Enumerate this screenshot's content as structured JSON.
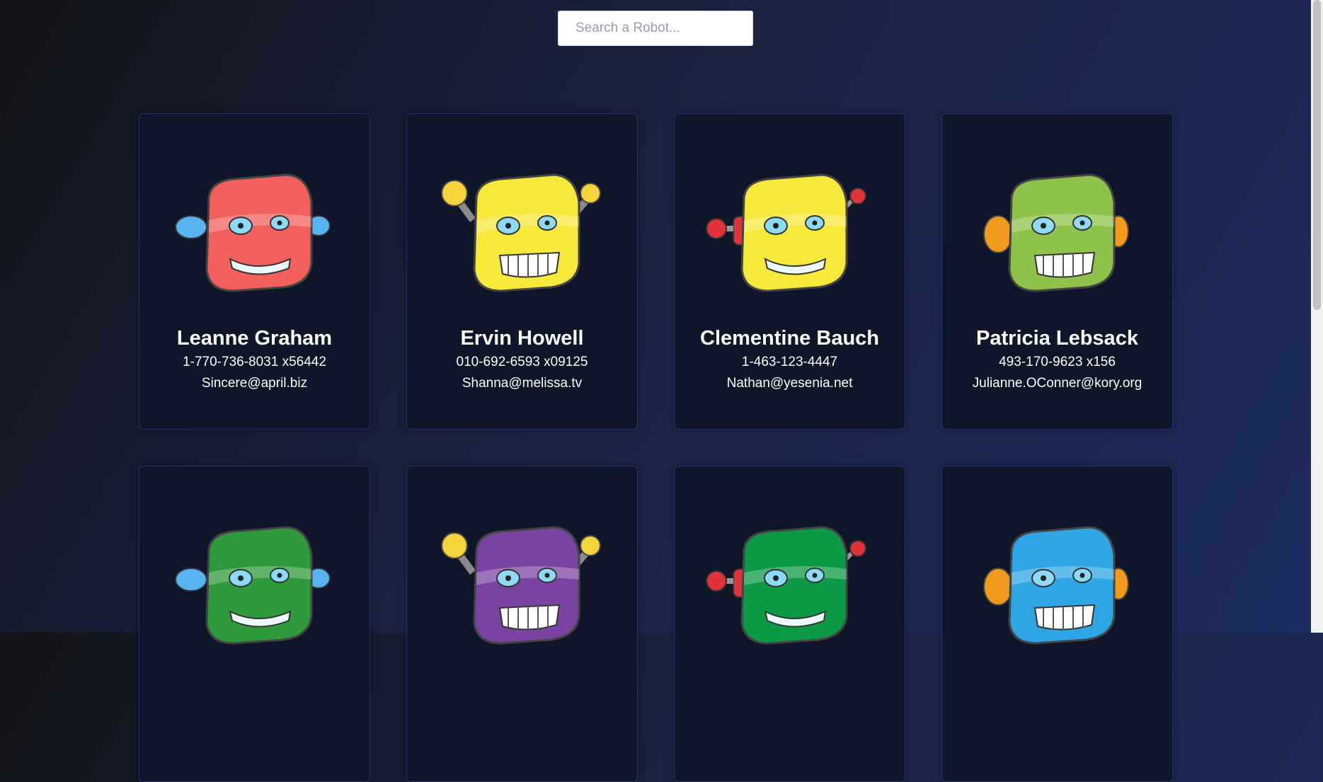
{
  "search": {
    "placeholder": "Search a Robot..."
  },
  "robots": [
    {
      "name": "Leanne Graham",
      "phone": "1-770-736-8031 x56442",
      "email": "Sincere@april.biz",
      "color": "#f2605e"
    },
    {
      "name": "Ervin Howell",
      "phone": "010-692-6593 x09125",
      "email": "Shanna@melissa.tv",
      "color": "#f6e93b"
    },
    {
      "name": "Clementine Bauch",
      "phone": "1-463-123-4447",
      "email": "Nathan@yesenia.net",
      "color": "#f6e93b"
    },
    {
      "name": "Patricia Lebsack",
      "phone": "493-170-9623 x156",
      "email": "Julianne.OConner@kory.org",
      "color": "#8fc24a"
    },
    {
      "name": "",
      "phone": "",
      "email": "",
      "color": "#2f9a3c"
    },
    {
      "name": "",
      "phone": "",
      "email": "",
      "color": "#7b43a1"
    },
    {
      "name": "",
      "phone": "",
      "email": "",
      "color": "#0d9a47"
    },
    {
      "name": "",
      "phone": "",
      "email": "",
      "color": "#2ea6e6"
    }
  ]
}
